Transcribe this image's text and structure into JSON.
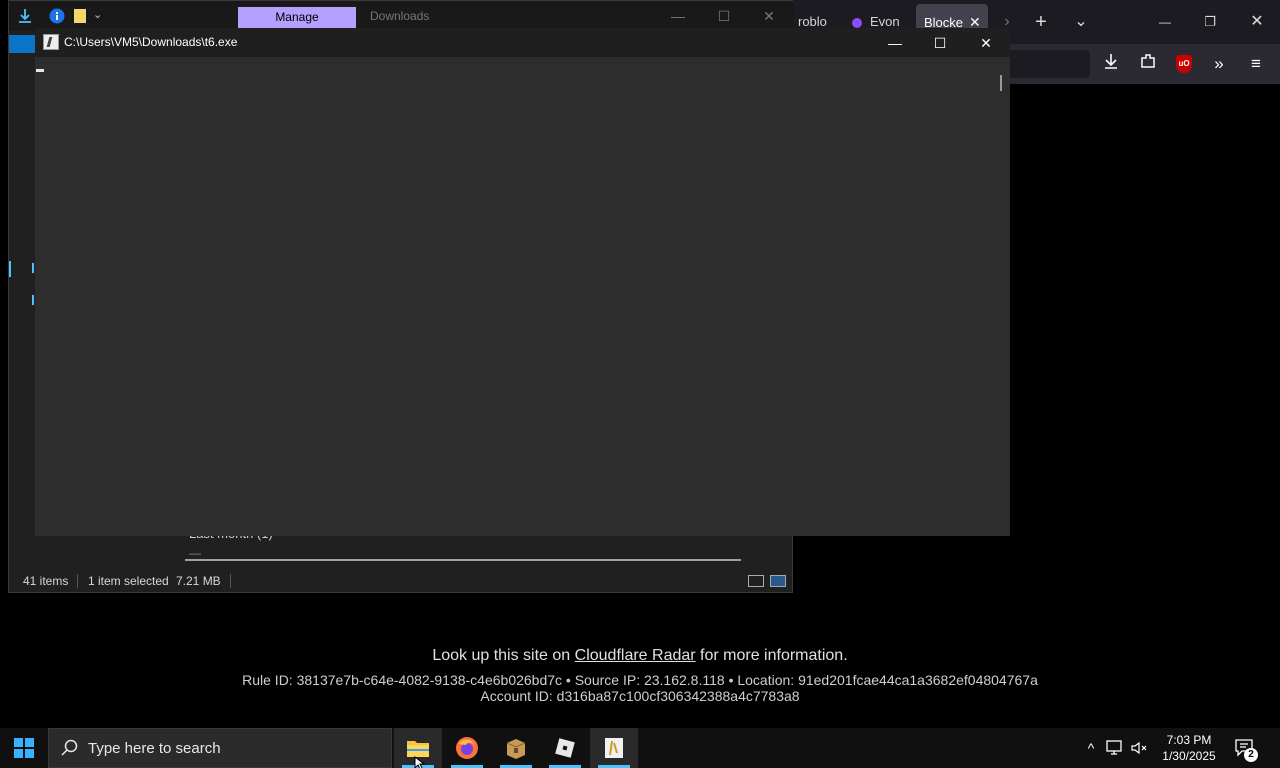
{
  "browser": {
    "tabs": [
      {
        "label": "roblo"
      },
      {
        "label": "Evon"
      },
      {
        "label": "Blocke"
      }
    ],
    "new_tab": "+",
    "list_tabs": "⌄",
    "minimize": "—",
    "restore": "❐",
    "close": "✕",
    "toolbar_icons": [
      "download-icon",
      "extensions-icon",
      "ublock-icon",
      "overflow-icon",
      "menu-icon"
    ],
    "ublock_label": "uO"
  },
  "cloudflare": {
    "lookup_prefix": "Look up this site on ",
    "lookup_link": "Cloudflare Radar",
    "lookup_suffix": " for more information.",
    "rule_line": "Rule ID: 38137e7b-c64e-4082-9138-c4e6b026bd7c • Source IP: 23.162.8.118 • Location: 91ed201fcae44ca1a3682ef04804767a",
    "account_line": "Account ID: d316ba87c100cf306342388a4c7783a8"
  },
  "explorer": {
    "ribbon_tab": "Manage",
    "title": "Downloads",
    "group_header": "Last month (1)",
    "group_dash": "—",
    "status": {
      "item_count": "41 items",
      "selection": "1 item selected",
      "size": "7.21 MB"
    }
  },
  "console": {
    "title": "C:\\Users\\VM5\\Downloads\\t6.exe",
    "minimize": "—",
    "maximize": "☐",
    "close": "✕"
  },
  "taskbar": {
    "search_placeholder": "Type here to search",
    "apps": [
      "file-explorer",
      "firefox",
      "package-installer",
      "roblox",
      "t6-console"
    ],
    "time": "7:03 PM",
    "date": "1/30/2025",
    "notification_count": "2",
    "tray_chevron": "^"
  }
}
